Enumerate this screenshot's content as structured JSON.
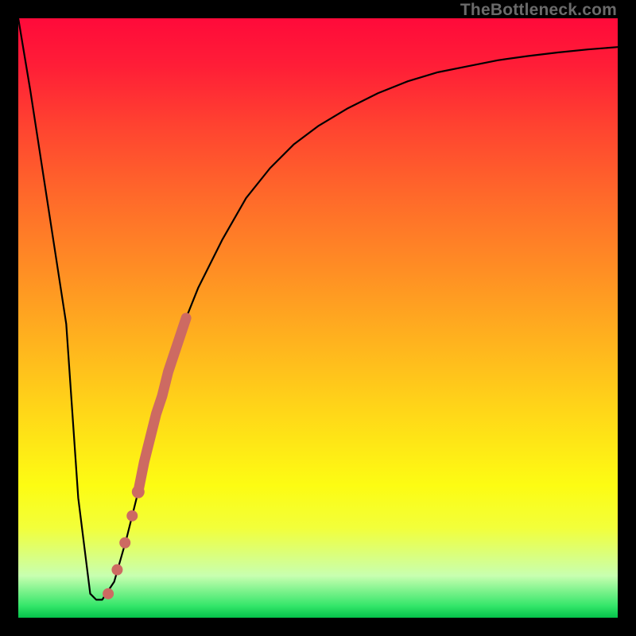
{
  "watermark": "TheBottleneck.com",
  "chart_data": {
    "type": "line",
    "title": "",
    "xlabel": "",
    "ylabel": "",
    "xlim": [
      0,
      100
    ],
    "ylim": [
      0,
      100
    ],
    "grid": false,
    "legend": false,
    "annotations": [],
    "series": [
      {
        "name": "bottleneck-curve",
        "color": "#000000",
        "x": [
          0,
          2,
          4,
          6,
          8,
          10,
          12,
          13,
          14,
          16,
          18,
          20,
          22,
          24,
          26,
          28,
          30,
          34,
          38,
          42,
          46,
          50,
          55,
          60,
          65,
          70,
          75,
          80,
          85,
          90,
          95,
          100
        ],
        "y": [
          100,
          88,
          75,
          62,
          49,
          20,
          4,
          3,
          3,
          6,
          13,
          21,
          30,
          37,
          44,
          50,
          55,
          63,
          70,
          75,
          79,
          82,
          85,
          87.5,
          89.5,
          91,
          92,
          93,
          93.7,
          94.3,
          94.8,
          95.2
        ]
      },
      {
        "name": "highlight-segment",
        "color": "#cd6a62",
        "style": "thick",
        "x": [
          20,
          21,
          22,
          23,
          24,
          25,
          26,
          27,
          28
        ],
        "y": [
          21,
          26,
          30,
          34,
          37,
          41,
          44,
          47,
          50
        ]
      },
      {
        "name": "highlight-dots",
        "color": "#cd6a62",
        "style": "dots",
        "x": [
          15.0,
          16.5,
          17.8,
          19.0,
          20.0
        ],
        "y": [
          4.0,
          8.0,
          12.5,
          17.0,
          21.0
        ]
      }
    ]
  }
}
